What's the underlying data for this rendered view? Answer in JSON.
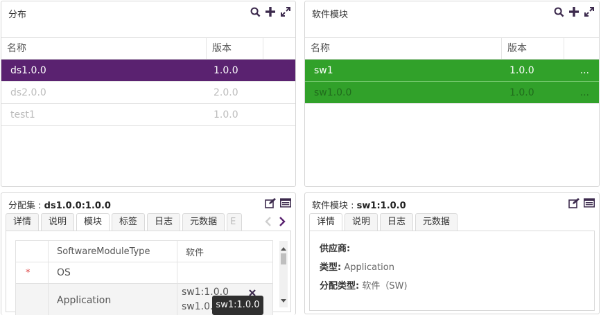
{
  "dist_panel": {
    "title": "分布",
    "columns": [
      "名称",
      "版本"
    ],
    "rows": [
      {
        "name": "ds1.0.0",
        "version": "1.0.0"
      },
      {
        "name": "ds2.0.0",
        "version": "2.0.0"
      },
      {
        "name": "test1",
        "version": "1.0.0"
      }
    ]
  },
  "sw_panel": {
    "title": "软件模块",
    "columns": [
      "名称",
      "版本"
    ],
    "rows": [
      {
        "name": "sw1",
        "version": "1.0.0",
        "more": "..."
      },
      {
        "name": "sw1.0.0",
        "version": "1.0.0",
        "more": "..."
      }
    ]
  },
  "set_panel": {
    "title_prefix": "分配集 : ",
    "title_value": "ds1.0.0:1.0.0",
    "tabs": [
      "详情",
      "说明",
      "模块",
      "标签",
      "日志",
      "元数据",
      "E"
    ],
    "table_headers": [
      "SoftwareModuleType",
      "软件"
    ],
    "rows": [
      {
        "required": "*",
        "type": "OS",
        "software": ""
      },
      {
        "required": "",
        "type": "Application",
        "software": "sw1:1.0.0",
        "software2": "sw1.0.0"
      }
    ],
    "tooltip": "sw1:1.0.0"
  },
  "swd_panel": {
    "title_prefix": "软件模块 : ",
    "title_value": "sw1:1.0.0",
    "tabs": [
      "详情",
      "说明",
      "日志",
      "元数据"
    ],
    "details": [
      {
        "label": "供应商:",
        "value": ""
      },
      {
        "label": "类型:",
        "value": "Application"
      },
      {
        "label": "分配类型:",
        "value": "软件（SW)"
      }
    ]
  },
  "colors": {
    "accent_purple": "#5a2270",
    "accent_green": "#31a12a",
    "icon": "#3c2a4d"
  }
}
